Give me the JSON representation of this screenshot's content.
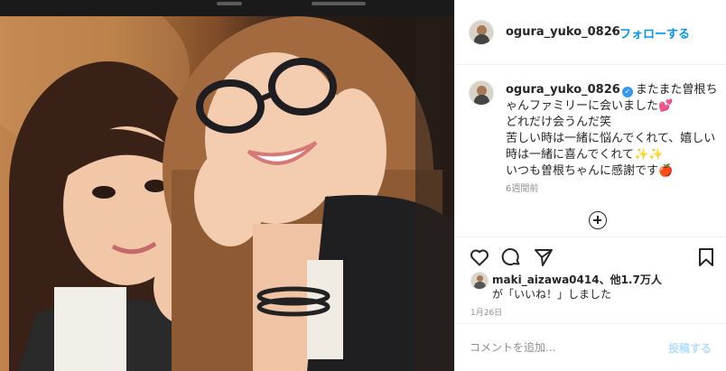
{
  "post": {
    "username": "ogura_yuko_0826",
    "separator": "•",
    "follow_label": "フォローする",
    "caption_lines": [
      "またまた曽根ちゃんファミリーに会いました💕",
      "どれだけ会うんだ笑",
      "苦しい時は一緒に悩んでくれて、嬉しい時は一緒に喜んでくれて✨✨",
      "いつも曽根ちゃんに感謝です🍎"
    ],
    "time_ago": "6週間前",
    "likes_user": "maki_aizawa0414",
    "likes_others": "、他1.7万人",
    "likes_suffix": "が「いいね！」しました",
    "date": "1月26日",
    "comment_placeholder": "コメントを追加...",
    "post_button": "投稿する"
  },
  "icons": {
    "like": "heart-icon",
    "comment": "comment-bubble-icon",
    "share": "paper-plane-icon",
    "save": "bookmark-icon",
    "more": "plus-circle-icon",
    "verified": "verified-badge-icon"
  },
  "colors": {
    "accent": "#0095f6",
    "verified": "#3897f0",
    "muted": "#8e8e8e",
    "text": "#262626",
    "post_disabled": "#b2dffc"
  }
}
